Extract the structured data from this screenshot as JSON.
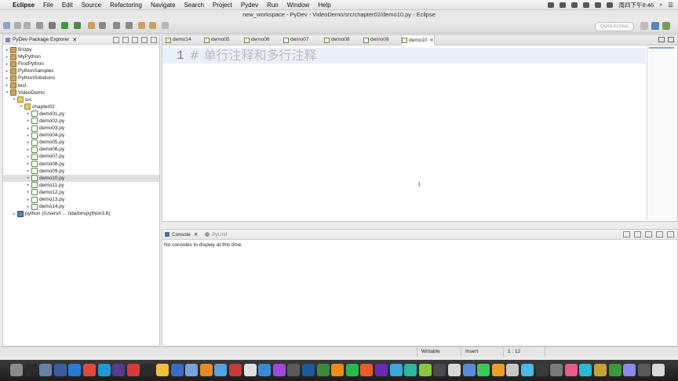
{
  "menubar": {
    "app_name": "Eclipse",
    "items": [
      "File",
      "Edit",
      "Source",
      "Refactoring",
      "Navigate",
      "Search",
      "Project",
      "Pydev",
      "Run",
      "Window",
      "Help"
    ],
    "clock": "周四下午8:46"
  },
  "window": {
    "title": "new_workspace - PyDev - VideoDemo/src/chapter02/demo10.py - Eclipse",
    "quick_access_placeholder": "Quick Access"
  },
  "explorer": {
    "title": "PyDev Package Explorer",
    "tree": [
      {
        "label": "firstpy",
        "depth": 0,
        "type": "project",
        "expanded": false
      },
      {
        "label": "MyPython",
        "depth": 0,
        "type": "project",
        "expanded": false
      },
      {
        "label": "FirstPython",
        "depth": 0,
        "type": "project",
        "expanded": false
      },
      {
        "label": "PythonSamples",
        "depth": 0,
        "type": "project",
        "expanded": false
      },
      {
        "label": "PythonSolutions",
        "depth": 0,
        "type": "project",
        "expanded": false
      },
      {
        "label": "test",
        "depth": 0,
        "type": "project",
        "expanded": false
      },
      {
        "label": "VideoDemo",
        "depth": 0,
        "type": "project",
        "expanded": true
      },
      {
        "label": "src",
        "depth": 1,
        "type": "folder",
        "expanded": true
      },
      {
        "label": "chapter02",
        "depth": 2,
        "type": "pkg",
        "expanded": true
      },
      {
        "label": "demo01.py",
        "depth": 3,
        "type": "py"
      },
      {
        "label": "demo02.py",
        "depth": 3,
        "type": "py"
      },
      {
        "label": "demo03.py",
        "depth": 3,
        "type": "py"
      },
      {
        "label": "demo04.py",
        "depth": 3,
        "type": "py"
      },
      {
        "label": "demo05.py",
        "depth": 3,
        "type": "py"
      },
      {
        "label": "demo06.py",
        "depth": 3,
        "type": "py"
      },
      {
        "label": "demo07.py",
        "depth": 3,
        "type": "py"
      },
      {
        "label": "demo08.py",
        "depth": 3,
        "type": "py"
      },
      {
        "label": "demo09.py",
        "depth": 3,
        "type": "py"
      },
      {
        "label": "demo10.py",
        "depth": 3,
        "type": "py",
        "selected": true
      },
      {
        "label": "demo11.py",
        "depth": 3,
        "type": "py"
      },
      {
        "label": "demo12.py",
        "depth": 3,
        "type": "py"
      },
      {
        "label": "demo13.py",
        "depth": 3,
        "type": "py"
      },
      {
        "label": "demo14.py",
        "depth": 3,
        "type": "py"
      },
      {
        "label": "python  (/Users/l ... nda/bin/python3.6)",
        "depth": 1,
        "type": "interp",
        "expanded": false
      }
    ]
  },
  "editor": {
    "tabs": [
      "demo14",
      "demo05",
      "demo06",
      "demo07",
      "demo08",
      "demo09",
      "demo10"
    ],
    "active_tab": "demo10",
    "line_number": "1",
    "code_line": "#  单行注释和多行注释"
  },
  "console": {
    "tab_console": "Console",
    "tab_pyunit": "PyUnit",
    "message": "No consoles to display at this time."
  },
  "status": {
    "writable": "Writable",
    "insert": "Insert",
    "position": "1 : 12"
  }
}
